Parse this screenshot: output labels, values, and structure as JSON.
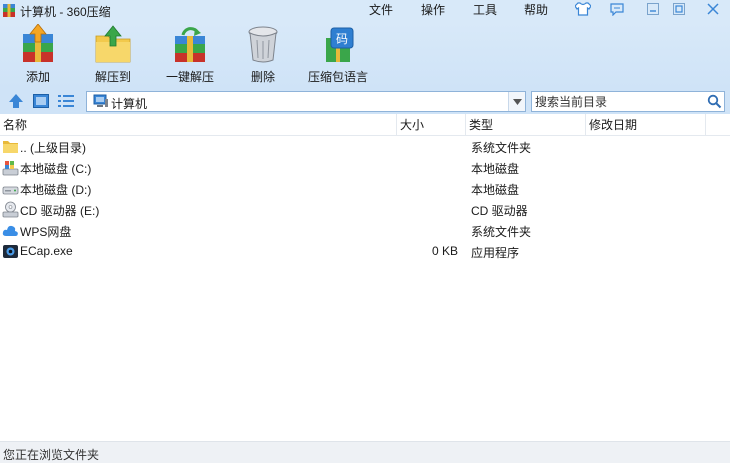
{
  "window": {
    "title": "计算机 - 360压缩"
  },
  "menu": [
    "文件",
    "操作",
    "工具",
    "帮助"
  ],
  "title_buttons": [
    "skin-icon",
    "feedback-icon",
    "minimize-icon",
    "maximize-icon",
    "close-icon"
  ],
  "toolbar": {
    "add": "添加",
    "extract_to": "解压到",
    "one_click_extract": "一键解压",
    "delete": "删除",
    "language_pack": "压缩包语言",
    "language_badge": "码"
  },
  "address": {
    "path": "计算机",
    "search_placeholder": "搜索当前目录"
  },
  "columns": [
    "名称",
    "大小",
    "类型",
    "修改日期"
  ],
  "files": [
    {
      "name": ".. (上级目录)",
      "size": "",
      "type": "系统文件夹",
      "icon": "folder-icon"
    },
    {
      "name": "本地磁盘 (C:)",
      "size": "",
      "type": "本地磁盘",
      "icon": "system-drive-icon"
    },
    {
      "name": "本地磁盘 (D:)",
      "size": "",
      "type": "本地磁盘",
      "icon": "drive-icon"
    },
    {
      "name": "CD 驱动器 (E:)",
      "size": "",
      "type": "CD 驱动器",
      "icon": "cd-drive-icon"
    },
    {
      "name": "WPS网盘",
      "size": "",
      "type": "系统文件夹",
      "icon": "cloud-icon"
    },
    {
      "name": "ECap.exe",
      "size": "0 KB",
      "type": "应用程序",
      "icon": "app-exe-icon"
    }
  ],
  "status": "您正在浏览文件夹",
  "colors": {
    "chrome": "#d8e9f9",
    "accent": "#3a86d6",
    "winrar_green": "#3aa64a",
    "winrar_red": "#c8322a",
    "folder_yellow": "#f2c94c"
  }
}
